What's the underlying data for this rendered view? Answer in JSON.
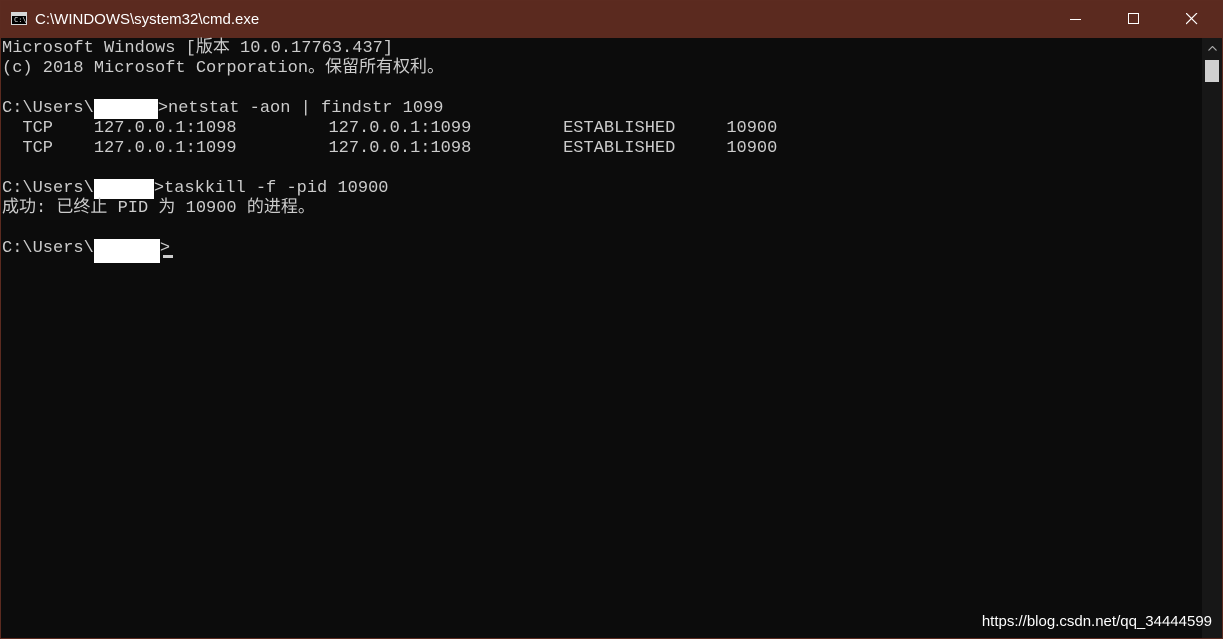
{
  "window": {
    "title": "C:\\WINDOWS\\system32\\cmd.exe",
    "icon_text": "C:\\"
  },
  "console": {
    "lines": [
      "Microsoft Windows [版本 10.0.17763.437]",
      "(c) 2018 Microsoft Corporation。保留所有权利。",
      "",
      "C:\\Users\\",
      "  TCP    127.0.0.1:1098         127.0.0.1:1099         ESTABLISHED     10900",
      "  TCP    127.0.0.1:1099         127.0.0.1:1098         ESTABLISHED     10900",
      "",
      "C:\\Users\\",
      "成功: 已终止 PID 为 10900 的进程。",
      "",
      "C:\\Users\\"
    ],
    "cmd1": ">netstat -aon | findstr 1099",
    "cmd2": ">taskkill -f -pid 10900",
    "prompt_end": ">"
  },
  "watermark": "https://blog.csdn.net/qq_34444599",
  "colors": {
    "titlebar": "#5b2a1f",
    "console_bg": "#0c0c0c",
    "console_text": "#cccccc"
  }
}
